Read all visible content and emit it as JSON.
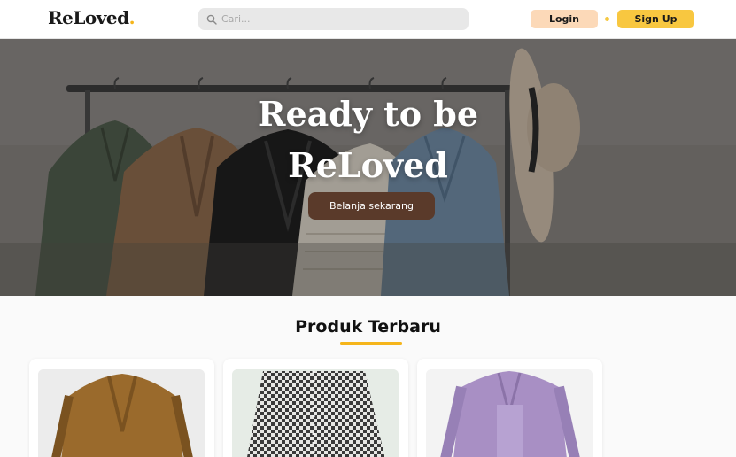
{
  "header": {
    "logo_text": "ReLoved",
    "logo_dot": ".",
    "search_placeholder": "Cari...",
    "login_label": "Login",
    "signup_label": "Sign Up"
  },
  "hero": {
    "title": "Ready to be\nReLoved",
    "cta_label": "Belanja sekarang"
  },
  "products": {
    "section_title": "Produk Terbaru",
    "items": [
      {
        "image": "brown-corduroy-blazer"
      },
      {
        "image": "houndstooth-skirt"
      },
      {
        "image": "lilac-shirt-set"
      }
    ]
  },
  "colors": {
    "accent": "#f5b51b",
    "login_bg": "#fcd9b8",
    "signup_bg": "#f8c740",
    "cta_bg": "#5a3a2a"
  },
  "icons": [
    "search-icon"
  ]
}
